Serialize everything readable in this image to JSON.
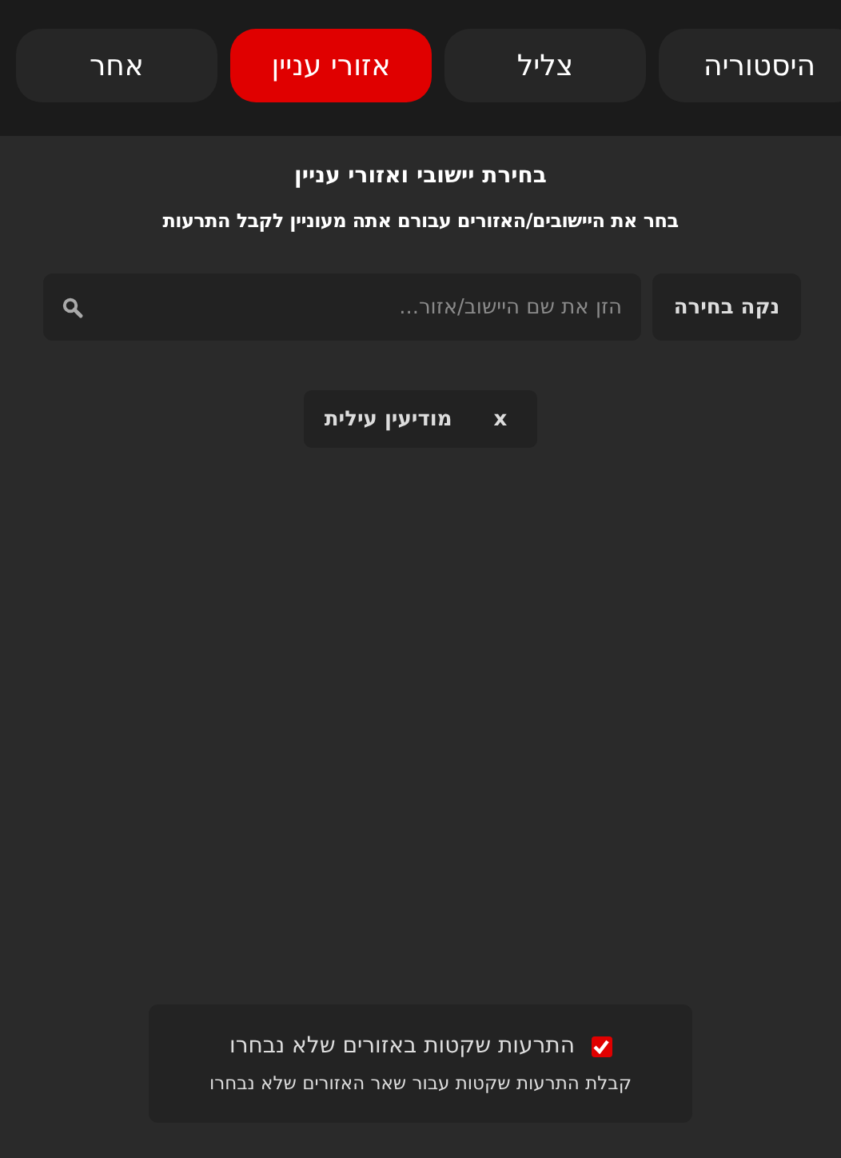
{
  "tabs": [
    {
      "label": "היסטוריה",
      "selected": false
    },
    {
      "label": "צליל",
      "selected": false
    },
    {
      "label": "אזורי עניין",
      "selected": true
    },
    {
      "label": "אחר",
      "selected": false
    }
  ],
  "heading": "בחירת יישובי ואזורי עניין",
  "subheading": "בחר את היישובים/האזורים עבורם אתה מעוניין לקבל התרעות",
  "clear_button": "נקה בחירה",
  "search": {
    "placeholder": "הזן את שם היישוב/אזור..."
  },
  "chips": [
    {
      "label": "מודיעין עילית",
      "remove": "x"
    }
  ],
  "quiet_alerts": {
    "checked": true,
    "label": "התרעות שקטות באזורים שלא נבחרו",
    "description": "קבלת התרעות שקטות עבור שאר האזורים שלא נבחרו"
  }
}
